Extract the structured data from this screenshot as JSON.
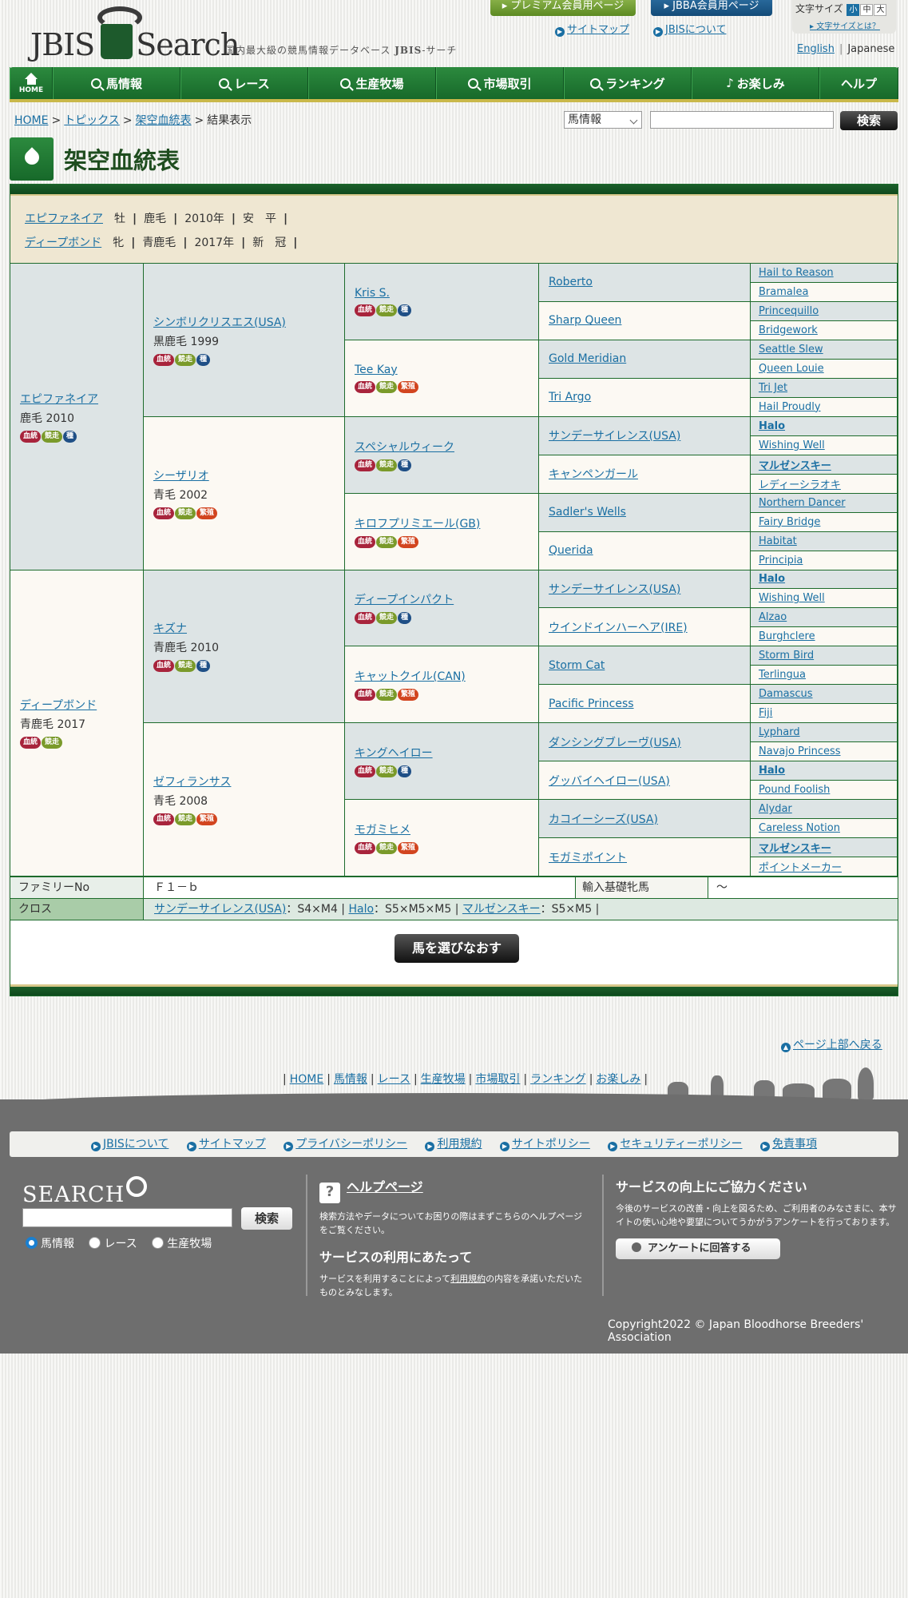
{
  "header": {
    "logo_text_1": "JBIS",
    "logo_text_2": "Search",
    "tagline_prefix": "国内最大級の競馬情報データベース",
    "tagline_brand": "JBIS",
    "tagline_suffix": "-サーチ",
    "premium_button": "プレミアム会員用ページ",
    "jbba_button": "JBBA会員用ページ",
    "sitemap_link": "サイトマップ",
    "about_link": "JBISについて",
    "font_size_label": "文字サイズ",
    "font_sizes": [
      "小",
      "中",
      "大"
    ],
    "font_size_help": "文字サイズとは？",
    "lang_english": "English",
    "lang_japanese": "Japanese"
  },
  "nav": {
    "home": "HOME",
    "items": [
      "馬情報",
      "レース",
      "生産牧場",
      "市場取引",
      "ランキング",
      "お楽しみ",
      "ヘルプ"
    ]
  },
  "breadcrumb": [
    "HOME",
    "トピックス",
    "架空血統表",
    "結果表示"
  ],
  "search": {
    "selected": "馬情報",
    "button": "検索"
  },
  "page_title": "架空血統表",
  "parents": [
    {
      "name": "エピファネイア",
      "sex": "牡",
      "color": "鹿毛",
      "year": "2010年",
      "area": "安　平"
    },
    {
      "name": "ディープボンド",
      "sex": "牝",
      "color": "青鹿毛",
      "year": "2017年",
      "area": "新　冠"
    }
  ],
  "icons": {
    "k": "血統",
    "s": "競走",
    "t": "種",
    "h": "繁殖"
  },
  "pedigree": {
    "g1": [
      {
        "name": "エピファネイア",
        "sub": "鹿毛 2010",
        "icons": [
          "k",
          "s",
          "t"
        ]
      },
      {
        "name": "ディープボンド",
        "sub": "青鹿毛 2017",
        "icons": [
          "k",
          "s"
        ]
      }
    ],
    "g2": [
      {
        "name": "シンボリクリスエス(USA)",
        "sub": "黒鹿毛 1999",
        "icons": [
          "k",
          "s",
          "t"
        ]
      },
      {
        "name": "シーザリオ",
        "sub": "青毛 2002",
        "icons": [
          "k",
          "s",
          "h"
        ]
      },
      {
        "name": "キズナ",
        "sub": "青鹿毛 2010",
        "icons": [
          "k",
          "s",
          "t"
        ]
      },
      {
        "name": "ゼフィランサス",
        "sub": "青毛 2008",
        "icons": [
          "k",
          "s",
          "h"
        ]
      }
    ],
    "g3": [
      {
        "name": "Kris S.",
        "icons": [
          "k",
          "s",
          "t"
        ]
      },
      {
        "name": "Tee Kay",
        "icons": [
          "k",
          "s",
          "h"
        ]
      },
      {
        "name": "スペシャルウィーク",
        "icons": [
          "k",
          "s",
          "t"
        ]
      },
      {
        "name": "キロフプリミエール(GB)",
        "icons": [
          "k",
          "s",
          "h"
        ]
      },
      {
        "name": "ディープインパクト",
        "icons": [
          "k",
          "s",
          "t"
        ]
      },
      {
        "name": "キャットクイル(CAN)",
        "icons": [
          "k",
          "s",
          "h"
        ]
      },
      {
        "name": "キングヘイロー",
        "icons": [
          "k",
          "s",
          "t"
        ]
      },
      {
        "name": "モガミヒメ",
        "icons": [
          "k",
          "s",
          "h"
        ]
      }
    ],
    "g4": [
      "Roberto",
      "Sharp Queen",
      "Gold Meridian",
      "Tri Argo",
      "サンデーサイレンス(USA)",
      "キャンペンガール",
      "Sadler's Wells",
      "Querida",
      "サンデーサイレンス(USA)",
      "ウインドインハーヘア(IRE)",
      "Storm Cat",
      "Pacific Princess",
      "ダンシングブレーヴ(USA)",
      "グッバイヘイロー(USA)",
      "カコイーシーズ(USA)",
      "モガミポイント"
    ],
    "g5": [
      "Hail to Reason",
      "Bramalea",
      "Princequillo",
      "Bridgework",
      "Seattle Slew",
      "Queen Louie",
      "Tri Jet",
      "Hail Proudly",
      "Halo",
      "Wishing Well",
      "マルゼンスキー",
      "レディーシラオキ",
      "Northern Dancer",
      "Fairy Bridge",
      "Habitat",
      "Principia",
      "Halo",
      "Wishing Well",
      "Alzao",
      "Burghclere",
      "Storm Bird",
      "Terlingua",
      "Damascus",
      "Fiji",
      "Lyphard",
      "Navajo Princess",
      "Halo",
      "Pound Foolish",
      "Alydar",
      "Careless Notion",
      "マルゼンスキー",
      "ポイントメーカー"
    ],
    "g5_bold": [
      8,
      10,
      16,
      26,
      30
    ]
  },
  "info": {
    "family_label": "ファミリーNo",
    "family_value": "Ｆ１－ｂ",
    "import_label": "輸入基礎牝馬",
    "import_value": "～",
    "cross_label": "クロス",
    "crosses": [
      {
        "name": "サンデーサイレンス(USA)",
        "value": "：S4×M4"
      },
      {
        "name": "Halo",
        "value": "：S5×M5×M5"
      },
      {
        "name": "マルゼンスキー",
        "value": "：S5×M5"
      }
    ]
  },
  "rechoose_button": "馬を選びなおす",
  "page_top": "ページ上部へ戻る",
  "footer_nav": [
    "HOME",
    "馬情報",
    "レース",
    "生産牧場",
    "市場取引",
    "ランキング",
    "お楽しみ"
  ],
  "footer": {
    "links": [
      "JBISについて",
      "サイトマップ",
      "プライバシーポリシー",
      "利用規約",
      "サイトポリシー",
      "セキュリティーポリシー",
      "免責事項"
    ],
    "search_logo": "SEARCH",
    "search_button": "検索",
    "radios": [
      "馬情報",
      "レース",
      "生産牧場"
    ],
    "help_title": "ヘルプページ",
    "help_text": "検索方法やデータについてお困りの際はまずこちらのヘルプページをご覧ください。",
    "service_title": "サービスの利用にあたって",
    "service_text_1": "サービスを利用することによって",
    "service_link": "利用規約",
    "service_text_2": "の内容を承諾いただいたものとみなします。",
    "survey_title": "サービスの向上にご協力ください",
    "survey_text": "今後のサービスの改善・向上を図るため、ご利用者のみなさまに、本サイトの使い心地や要望についてうかがうアンケートを行っております。",
    "survey_button": "アンケートに回答する",
    "copyright": "Copyright2022 © Japan Bloodhorse Breeders' Association"
  },
  "colors": {
    "brand_green": "#1f7a34",
    "link": "#1a6fa3",
    "accent_gold": "#c9b84a"
  }
}
